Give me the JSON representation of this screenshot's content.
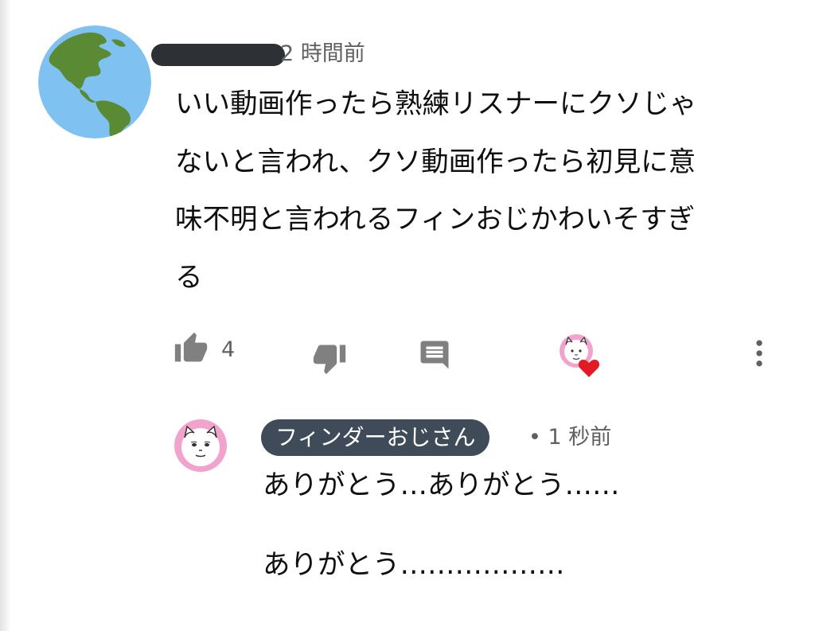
{
  "comment": {
    "author_redacted": true,
    "timestamp": "2 時間前",
    "text": "いい動画作ったら熟練リスナーにクソじゃ\nないと言われ、クソ動画作ったら初見に意\n味不明と言われるフィンおじかわいそすぎ\nる",
    "like_count": "4",
    "icons": {
      "avatar": "globe-americas-icon",
      "like": "thumbs-up-icon",
      "dislike": "thumbs-down-icon",
      "reply": "comment-reply-icon",
      "heart": "creator-heart-icon",
      "more": "more-vertical-icon"
    }
  },
  "reply": {
    "author": "フィンダーおじさん",
    "timestamp": "• 1 秒前",
    "text": "ありがとう…ありがとう……\n\nありがとう………………"
  },
  "colors": {
    "text_primary": "#0f0f0f",
    "text_secondary": "#606060",
    "icon_gray": "#808080",
    "creator_badge_bg": "#3f4b58",
    "globe_ocean": "#7fc1f0",
    "globe_land": "#5a8b34",
    "avatar_pink": "#f2a3cd",
    "heart_red": "#e01b24"
  }
}
